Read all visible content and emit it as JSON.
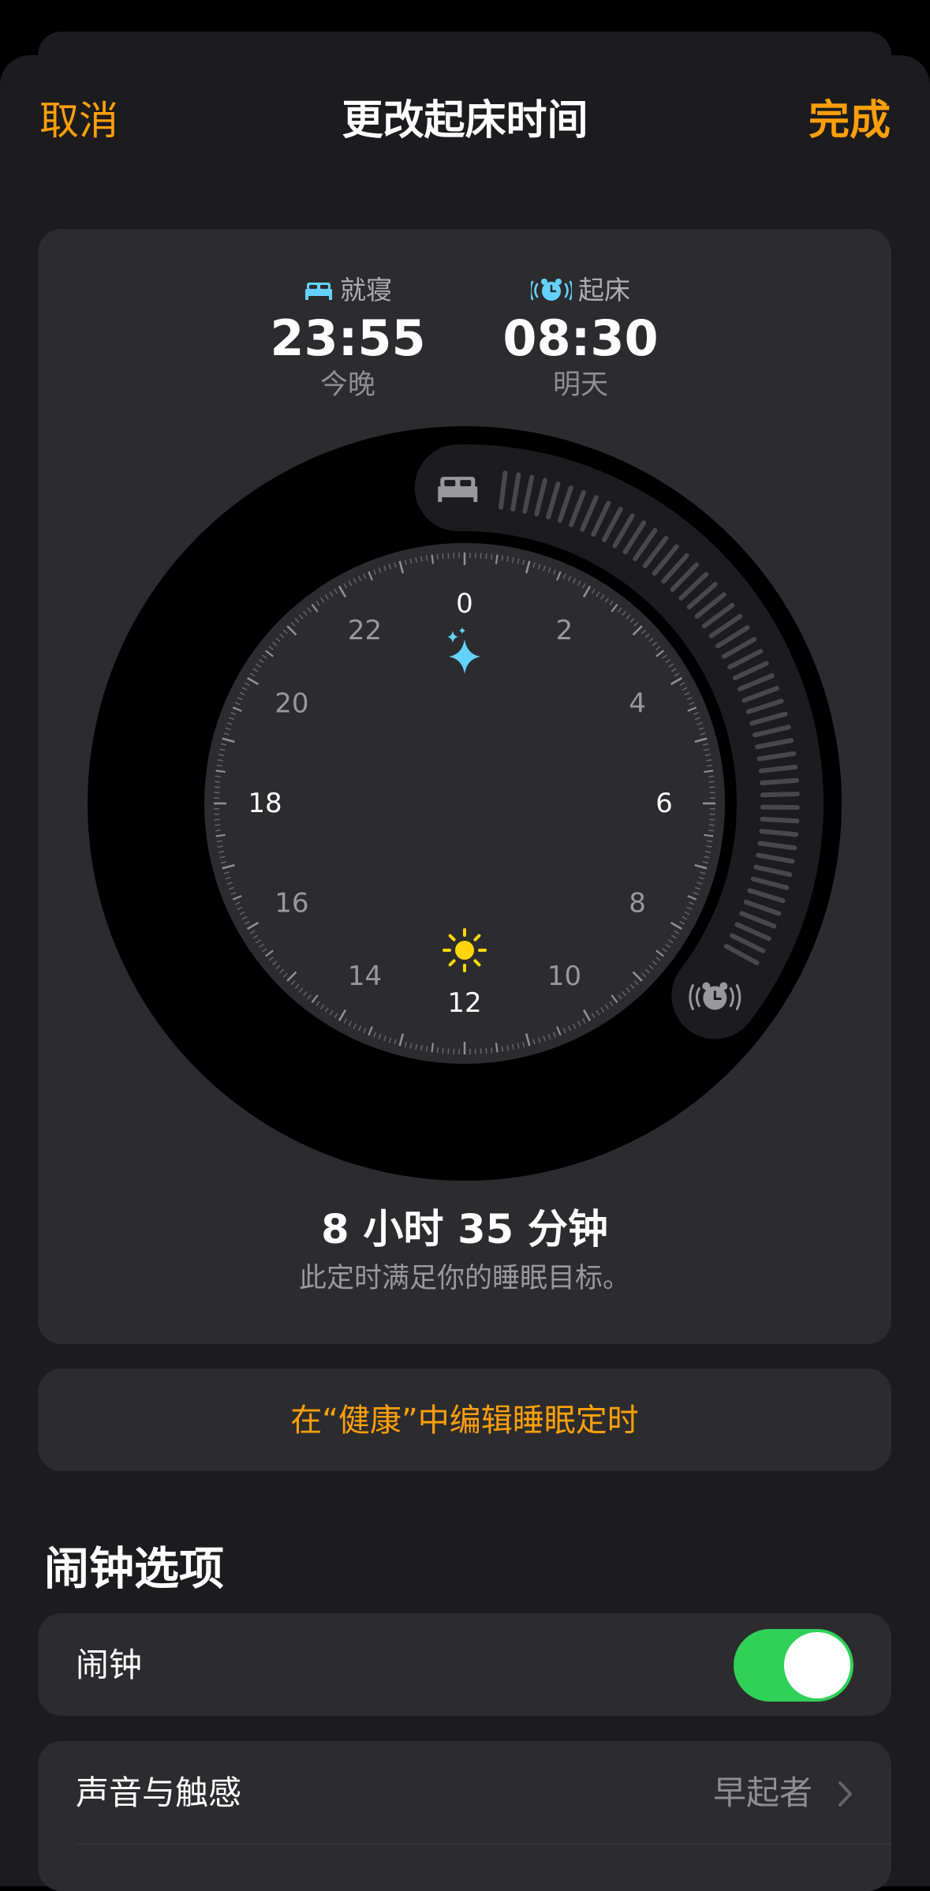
{
  "nav": {
    "cancel": "取消",
    "title": "更改起床时间",
    "done": "完成"
  },
  "schedule": {
    "bedtime": {
      "label": "就寝",
      "time": "23:55",
      "day": "今晚",
      "icon": "bed-icon"
    },
    "wake": {
      "label": "起床",
      "time": "08:30",
      "day": "明天",
      "icon": "alarm-clock-icon"
    }
  },
  "dial": {
    "hour_labels": [
      "0",
      "2",
      "4",
      "6",
      "8",
      "10",
      "12",
      "14",
      "16",
      "18",
      "20",
      "22"
    ],
    "bedtime_hours": 23.9167,
    "wake_hours": 8.5,
    "accent_color": "#64d2ff",
    "night_icon": "sparkles-icon",
    "day_icon": "sun-icon"
  },
  "summary": {
    "duration": "8 小时 35 分钟",
    "goal": "此定时满足你的睡眠目标。"
  },
  "edit_link": "在“健康”中编辑睡眠定时",
  "alarm_options": {
    "title": "闹钟选项",
    "alarm_label": "闹钟",
    "alarm_on": true,
    "sound_label": "声音与触感",
    "sound_value": "早起者"
  },
  "colors": {
    "accent": "#ff9f0a",
    "toggle_on": "#30d158",
    "sleep_icon": "#64d2ff"
  }
}
